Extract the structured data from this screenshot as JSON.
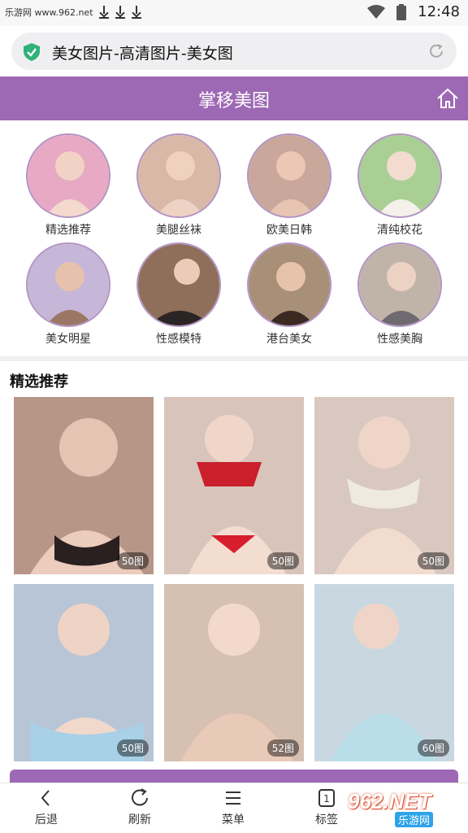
{
  "status_bar": {
    "left_text": "乐游网 www.962.net",
    "time": "12:48"
  },
  "url_bar": {
    "title": "美女图片-高清图片-美女图"
  },
  "header": {
    "title": "掌移美图"
  },
  "categories": [
    {
      "label": "精选推荐",
      "color": "#e7a9c4"
    },
    {
      "label": "美腿丝袜",
      "color": "#d9b8a8"
    },
    {
      "label": "欧美日韩",
      "color": "#c9a79a"
    },
    {
      "label": "清纯校花",
      "color": "#a9cf95"
    },
    {
      "label": "美女明星",
      "color": "#c6b6d8"
    },
    {
      "label": "性感模特",
      "color": "#8f6e5a"
    },
    {
      "label": "港台美女",
      "color": "#a88f78"
    },
    {
      "label": "性感美胸",
      "color": "#c0b4a9"
    }
  ],
  "section": {
    "title": "精选推荐"
  },
  "photos": [
    {
      "count": "50图",
      "color": "#b79688"
    },
    {
      "count": "50图",
      "color": "#d9c4bb"
    },
    {
      "count": "50图",
      "color": "#d8c8c0"
    },
    {
      "count": "50图",
      "color": "#b8c5d6"
    },
    {
      "count": "52图",
      "color": "#d6c0b2"
    },
    {
      "count": "60图",
      "color": "#c9d8e0"
    }
  ],
  "bottom_nav": [
    {
      "label": "后退",
      "icon": "back-icon"
    },
    {
      "label": "刷新",
      "icon": "refresh-icon"
    },
    {
      "label": "菜单",
      "icon": "menu-icon"
    },
    {
      "label": "标签",
      "icon": "tabs-icon"
    }
  ],
  "tabs_count": "1",
  "watermark": {
    "number": "962.NET",
    "sub": "乐游网"
  },
  "colors": {
    "accent": "#9d68b4",
    "shield": "#2fb17a"
  }
}
